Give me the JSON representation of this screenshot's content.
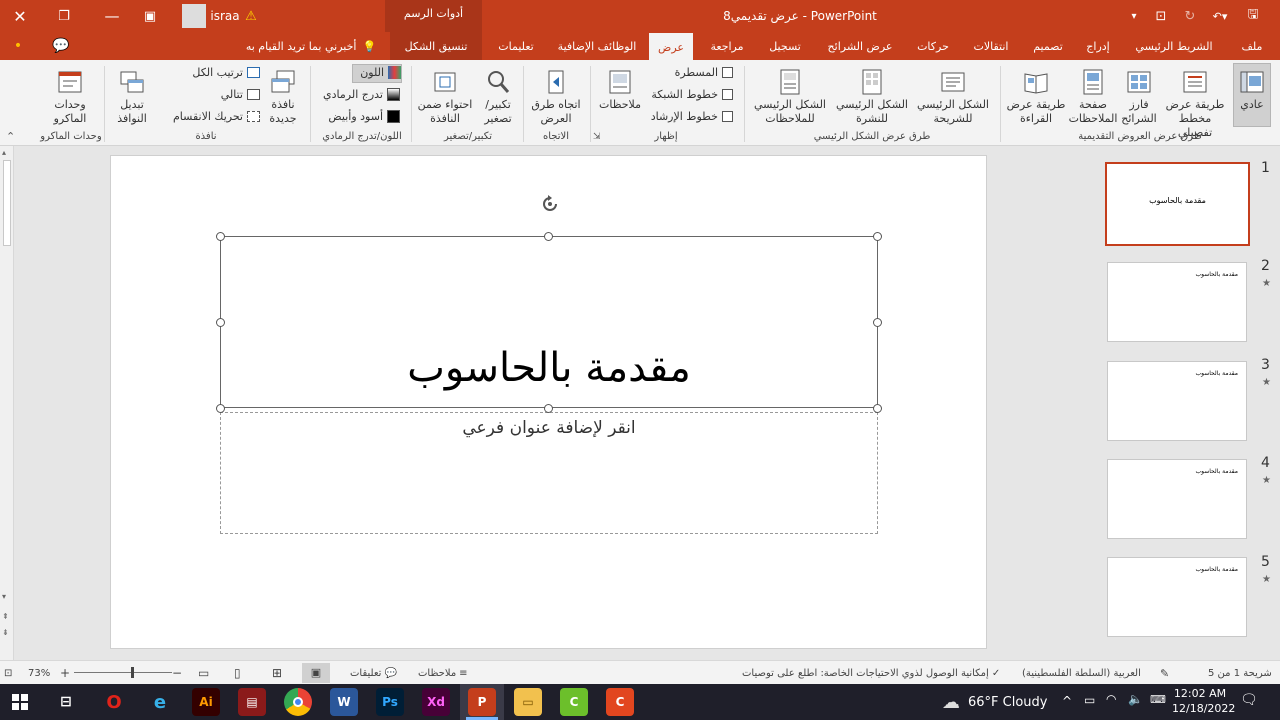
{
  "titlebar": {
    "title": "عرض تقديمي8  -  PowerPoint",
    "context_group": "أدوات الرسم",
    "user": "israa"
  },
  "tabs": {
    "file": "ملف",
    "home": "الشريط الرئيسي",
    "insert": "إدراج",
    "design": "تصميم",
    "transitions": "انتقالات",
    "animations": "حركات",
    "slideshow": "عرض الشرائح",
    "record": "تسجيل",
    "review": "مراجعة",
    "view": "عرض",
    "addins": "الوظائف الإضافية",
    "help": "تعليمات",
    "format": "تنسيق الشكل",
    "tellme": "أخبرني بما تريد القيام به"
  },
  "ribbon": {
    "normal": "عادي",
    "outline": "طريقة عرض مخطط تفصيلي",
    "sorter": "فارز الشرائح",
    "notes_page": "صفحة الملاحظات",
    "reading": "طريقة عرض القراءة",
    "group_views": "طرق عرض العروض التقديمية",
    "slide_master": "الشكل الرئيسي للشريحة",
    "handout_master": "الشكل الرئيسي للنشرة",
    "notes_master": "الشكل الرئيسي للملاحظات",
    "group_master": "طرق عرض الشكل الرئيسي",
    "ruler": "المسطرة",
    "gridlines": "خطوط الشبكة",
    "guides": "خطوط الإرشاد",
    "group_show": "إظهار",
    "notes": "ملاحظات",
    "direction": "اتجاه طرق العرض",
    "group_direction": "الاتجاه",
    "zoom": "تكبير/ تصغير",
    "fit": "احتواء ضمن النافذة",
    "group_zoom": "تكبير/تصغير",
    "color": "اللون",
    "grayscale": "تدرج الرمادي",
    "bw": "أسود وأبيض",
    "group_color": "اللون/تدرج الرمادي",
    "new_window": "نافذة جديدة",
    "arrange_all": "ترتيب الكل",
    "cascade": "تتالي",
    "move_split": "تحريك الانقسام",
    "switch_windows": "تبديل النوافذ",
    "group_window": "نافذة",
    "macros": "وحدات الماكرو",
    "group_macros": "وحدات الماكرو"
  },
  "slide": {
    "title": "مقدمة بالحاسوب",
    "subtitle_placeholder": "انقر لإضافة عنوان فرعي"
  },
  "thumbnails": [
    {
      "num": "1",
      "text": "مقدمة بالحاسوب"
    },
    {
      "num": "2",
      "text": "مقدمة بالحاسوب"
    },
    {
      "num": "3",
      "text": "مقدمة بالحاسوب"
    },
    {
      "num": "4",
      "text": "مقدمة بالحاسوب"
    },
    {
      "num": "5",
      "text": "مقدمة بالحاسوب"
    }
  ],
  "status": {
    "slide_of": "شريحة 1 من 5",
    "language": "العربية (السلطة الفلسطينية)",
    "accessibility": "إمكانية الوصول لذوي الاحتياجات الخاصة: اطلع على توصيات",
    "notes": "ملاحظات",
    "comments": "تعليقات",
    "zoom": "73%"
  },
  "taskbar": {
    "weather": "66°F  Cloudy",
    "time": "12:02 AM",
    "date": "12/18/2022"
  },
  "colors": {
    "accent": "#c43e1c"
  }
}
